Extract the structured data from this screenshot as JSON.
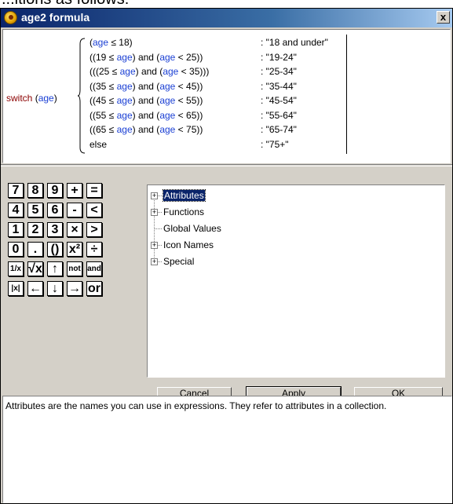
{
  "page_top_fragment": "...itions as follows:",
  "window": {
    "title": "age2 formula",
    "close_label": "x"
  },
  "formula": {
    "switch_keyword": "switch",
    "switch_arg": "age",
    "conditions": [
      {
        "tokens": [
          [
            "p",
            "("
          ],
          [
            "id",
            "age"
          ],
          [
            "p",
            " ≤ 18)"
          ]
        ],
        "result": ": \"18 and under\""
      },
      {
        "tokens": [
          [
            "p",
            "((19 ≤ "
          ],
          [
            "id",
            "age"
          ],
          [
            "p",
            ") and ("
          ],
          [
            "id",
            "age"
          ],
          [
            "p",
            " < 25))"
          ]
        ],
        "result": ": \"19-24\""
      },
      {
        "tokens": [
          [
            "p",
            "(((25 ≤ "
          ],
          [
            "id",
            "age"
          ],
          [
            "p",
            ") and ("
          ],
          [
            "id",
            "age"
          ],
          [
            "p",
            " < 35)))"
          ]
        ],
        "result": ": \"25-34\""
      },
      {
        "tokens": [
          [
            "p",
            "((35 ≤ "
          ],
          [
            "id",
            "age"
          ],
          [
            "p",
            ") and ("
          ],
          [
            "id",
            "age"
          ],
          [
            "p",
            " < 45))"
          ]
        ],
        "result": ": \"35-44\""
      },
      {
        "tokens": [
          [
            "p",
            "((45 ≤ "
          ],
          [
            "id",
            "age"
          ],
          [
            "p",
            ") and ("
          ],
          [
            "id",
            "age"
          ],
          [
            "p",
            " < 55))"
          ]
        ],
        "result": ": \"45-54\""
      },
      {
        "tokens": [
          [
            "p",
            "((55 ≤ "
          ],
          [
            "id",
            "age"
          ],
          [
            "p",
            ") and ("
          ],
          [
            "id",
            "age"
          ],
          [
            "p",
            " < 65))"
          ]
        ],
        "result": ": \"55-64\""
      },
      {
        "tokens": [
          [
            "p",
            "((65 ≤ "
          ],
          [
            "id",
            "age"
          ],
          [
            "p",
            ") and ("
          ],
          [
            "id",
            "age"
          ],
          [
            "p",
            " < 75))"
          ]
        ],
        "result": ": \"65-74\""
      },
      {
        "tokens": [
          [
            "p",
            "else"
          ]
        ],
        "result": ": \"75+\""
      }
    ]
  },
  "keypad": {
    "keys": [
      [
        "7",
        "8",
        "9",
        "+",
        "="
      ],
      [
        "4",
        "5",
        "6",
        "-",
        "<"
      ],
      [
        "1",
        "2",
        "3",
        "×",
        ">"
      ],
      [
        "0",
        ".",
        "()",
        "x²",
        "÷"
      ],
      [
        "1/x",
        "√x",
        "↑",
        "not",
        "and"
      ],
      [
        "|x|",
        "←",
        "↓",
        "→",
        "or"
      ]
    ]
  },
  "tree": {
    "items": [
      {
        "label": "Attributes",
        "expandable": true,
        "selected": true
      },
      {
        "label": "Functions",
        "expandable": true,
        "selected": false
      },
      {
        "label": "Global Values",
        "expandable": false,
        "selected": false
      },
      {
        "label": "Icon Names",
        "expandable": true,
        "selected": false
      },
      {
        "label": "Special",
        "expandable": true,
        "selected": false
      }
    ]
  },
  "buttons": {
    "cancel": "Cancel",
    "apply": "Apply",
    "ok": "OK"
  },
  "help_text": "Attributes are the names you can use in expressions. They refer to attributes in a collection.",
  "colors": {
    "title_bar": "#0a246a",
    "keyword": "#8b0000",
    "identifier": "#1a3fd4",
    "dialog_bg": "#d4d0c8"
  }
}
